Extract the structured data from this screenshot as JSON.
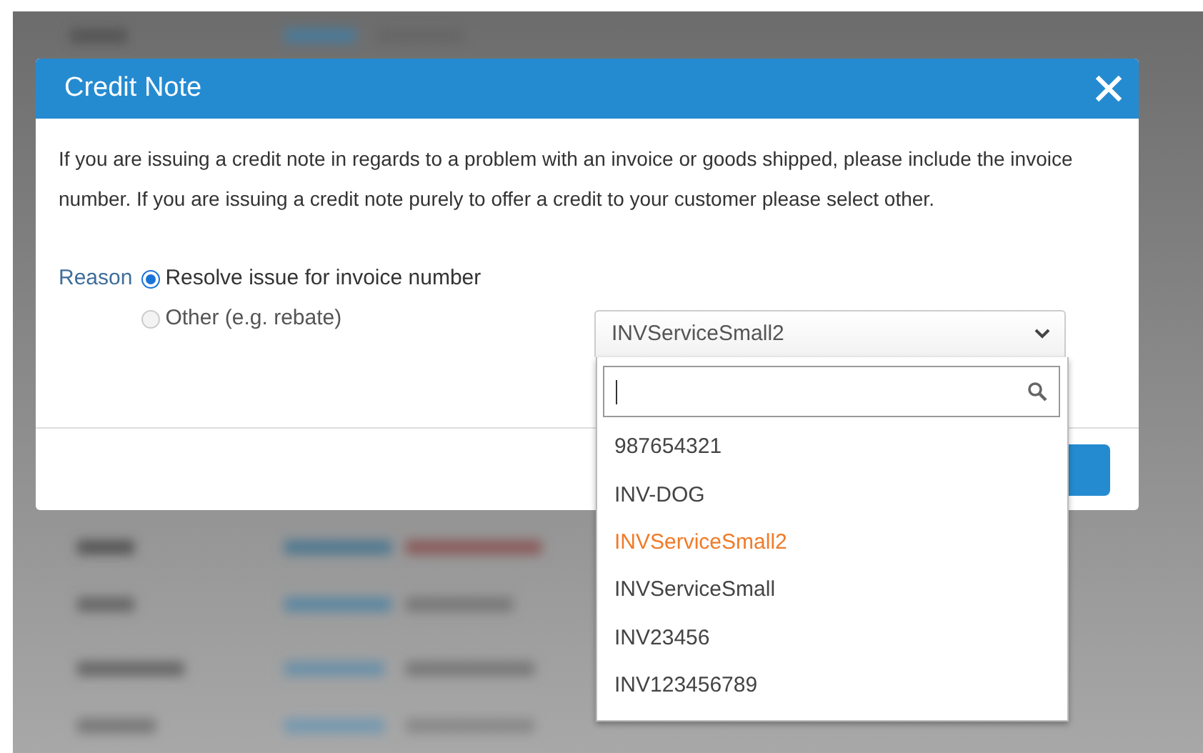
{
  "dialog": {
    "title": "Credit Note",
    "description": "If you are issuing a credit note in regards to a problem with an invoice or goods shipped, please include the invoice number. If you are issuing a credit note purely to offer a credit to your customer please select other.",
    "reason": {
      "label": "Reason",
      "options": [
        {
          "label": "Resolve issue for invoice number",
          "selected": true
        },
        {
          "label": "Other (e.g. rebate)",
          "selected": false
        }
      ]
    },
    "invoice_select": {
      "value": "INVServiceSmall2",
      "expanded": true,
      "options": [
        {
          "label": "987654321",
          "selected": false
        },
        {
          "label": "INV-DOG",
          "selected": false
        },
        {
          "label": "INVServiceSmall2",
          "selected": true
        },
        {
          "label": "INVServiceSmall",
          "selected": false
        },
        {
          "label": "INV23456",
          "selected": false
        },
        {
          "label": "INV123456789",
          "selected": false
        }
      ]
    }
  }
}
